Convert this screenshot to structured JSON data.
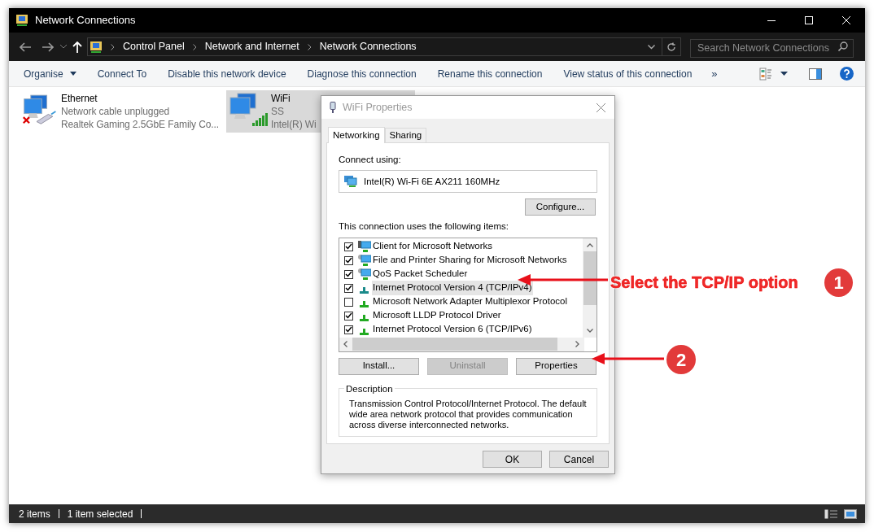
{
  "window": {
    "title": "Network Connections"
  },
  "address_bar": {
    "breadcrumbs": [
      "Control Panel",
      "Network and Internet",
      "Network Connections"
    ],
    "search_placeholder": "Search Network Connections"
  },
  "toolbar": {
    "items": [
      {
        "label": "Organise",
        "kind": "menu"
      },
      {
        "label": "Connect To",
        "kind": "plain"
      },
      {
        "label": "Disable this network device",
        "kind": "plain"
      },
      {
        "label": "Diagnose this connection",
        "kind": "plain"
      },
      {
        "label": "Rename this connection",
        "kind": "plain"
      },
      {
        "label": "View status of this connection",
        "kind": "plain"
      }
    ],
    "overflow": "»"
  },
  "connections": [
    {
      "name": "Ethernet",
      "status": "Network cable unplugged",
      "device": "Realtek Gaming 2.5GbE Family Co...",
      "kind": "wired",
      "selected": false
    },
    {
      "name": "WiFi",
      "status": "SS",
      "device": "Intel(R) Wi",
      "kind": "wireless",
      "selected": true
    }
  ],
  "dialog": {
    "title": "WiFi Properties",
    "tabs": [
      {
        "label": "Networking",
        "selected": true
      },
      {
        "label": "Sharing",
        "selected": false
      }
    ],
    "connect_using_label": "Connect using:",
    "adapter": "Intel(R) Wi-Fi 6E AX211 160MHz",
    "configure_button": "Configure...",
    "items_label": "This connection uses the following items:",
    "items": [
      {
        "label": "Client for Microsoft Networks",
        "checked": true,
        "selected": false,
        "kind": "client"
      },
      {
        "label": "File and Printer Sharing for Microsoft Networks",
        "checked": true,
        "selected": false,
        "kind": "service"
      },
      {
        "label": "QoS Packet Scheduler",
        "checked": true,
        "selected": false,
        "kind": "service"
      },
      {
        "label": "Internet Protocol Version 4 (TCP/IPv4)",
        "checked": true,
        "selected": true,
        "kind": "protocol"
      },
      {
        "label": "Microsoft Network Adapter Multiplexor Protocol",
        "checked": false,
        "selected": false,
        "kind": "protocol"
      },
      {
        "label": "Microsoft LLDP Protocol Driver",
        "checked": true,
        "selected": false,
        "kind": "protocol"
      },
      {
        "label": "Internet Protocol Version 6 (TCP/IPv6)",
        "checked": true,
        "selected": false,
        "kind": "protocol"
      }
    ],
    "buttons": [
      {
        "label": "Install...",
        "disabled": false
      },
      {
        "label": "Uninstall",
        "disabled": true
      },
      {
        "label": "Properties",
        "disabled": false
      }
    ],
    "description": {
      "heading": "Description",
      "text": "Transmission Control Protocol/Internet Protocol. The default wide area network protocol that provides communication across diverse interconnected networks."
    },
    "footer_buttons": [
      "OK",
      "Cancel"
    ]
  },
  "annotations": [
    {
      "text": "Select the TCP/IP option",
      "badge": "1"
    },
    {
      "badge": "2"
    }
  ],
  "status_bar": {
    "items": [
      "2 items",
      "1 item selected"
    ]
  }
}
